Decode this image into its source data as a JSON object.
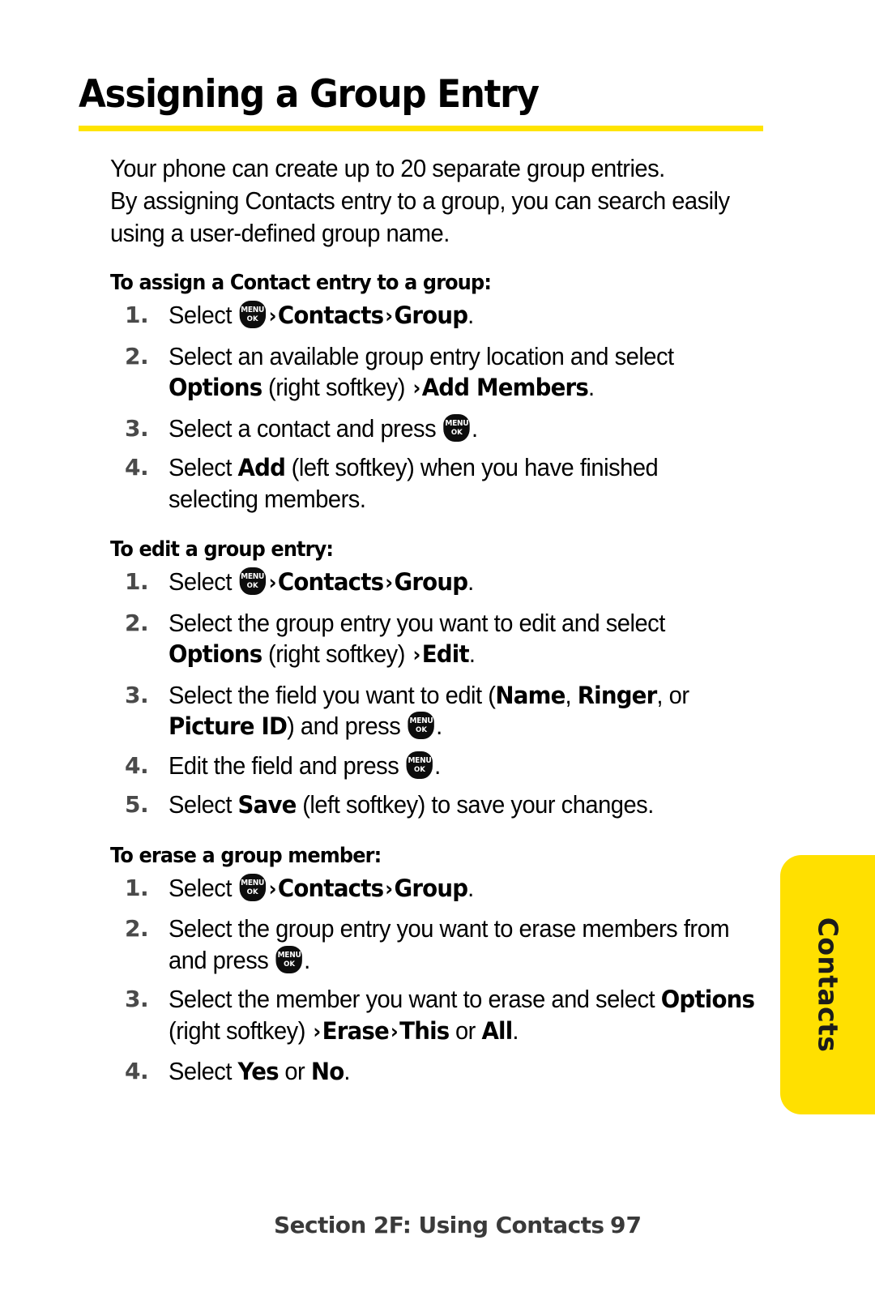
{
  "page": {
    "title": "Assigning a Group Entry",
    "accent_color": "#FFE400",
    "side_tab_label": "Contacts"
  },
  "intro": {
    "line1": "Your phone can create up to 20 separate group entries.",
    "line2": "By assigning Contacts entry to a group, you can search easily",
    "line3": "using a user-defined group name."
  },
  "sections": [
    {
      "heading": "To assign a Contact entry to a group:",
      "steps": [
        {
          "number": "1.",
          "parts": [
            {
              "t": "text",
              "v": "Select "
            },
            {
              "t": "menukey"
            },
            {
              "t": "gt"
            },
            {
              "t": "bold",
              "v": "Contacts"
            },
            {
              "t": "gt"
            },
            {
              "t": "bold",
              "v": "Group"
            },
            {
              "t": "text",
              "v": "."
            }
          ]
        },
        {
          "number": "2.",
          "parts": [
            {
              "t": "text",
              "v": "Select an available group entry location and select"
            },
            {
              "t": "br"
            },
            {
              "t": "bold",
              "v": "Options"
            },
            {
              "t": "text",
              "v": " (right softkey) "
            },
            {
              "t": "gt"
            },
            {
              "t": "bold",
              "v": "Add Members"
            },
            {
              "t": "text",
              "v": "."
            }
          ]
        },
        {
          "number": "3.",
          "parts": [
            {
              "t": "text",
              "v": "Select a contact and press "
            },
            {
              "t": "menukey"
            },
            {
              "t": "text",
              "v": "."
            }
          ]
        },
        {
          "number": "4.",
          "parts": [
            {
              "t": "text",
              "v": "Select "
            },
            {
              "t": "bold",
              "v": "Add"
            },
            {
              "t": "text",
              "v": " (left softkey) when you have finished"
            },
            {
              "t": "br"
            },
            {
              "t": "text",
              "v": "selecting members."
            }
          ]
        }
      ]
    },
    {
      "heading": "To edit a group entry:",
      "steps": [
        {
          "number": "1.",
          "parts": [
            {
              "t": "text",
              "v": "Select "
            },
            {
              "t": "menukey"
            },
            {
              "t": "gt"
            },
            {
              "t": "bold",
              "v": "Contacts"
            },
            {
              "t": "gt"
            },
            {
              "t": "bold",
              "v": "Group"
            },
            {
              "t": "text",
              "v": "."
            }
          ]
        },
        {
          "number": "2.",
          "parts": [
            {
              "t": "text",
              "v": "Select the group entry you want to edit and select"
            },
            {
              "t": "br"
            },
            {
              "t": "bold",
              "v": "Options"
            },
            {
              "t": "text",
              "v": " (right softkey) "
            },
            {
              "t": "gt"
            },
            {
              "t": "bold",
              "v": "Edit"
            },
            {
              "t": "text",
              "v": "."
            }
          ]
        },
        {
          "number": "3.",
          "parts": [
            {
              "t": "text",
              "v": "Select the field you want to edit ("
            },
            {
              "t": "bold",
              "v": "Name"
            },
            {
              "t": "text",
              "v": ", "
            },
            {
              "t": "bold",
              "v": "Ringer"
            },
            {
              "t": "text",
              "v": ", or"
            },
            {
              "t": "br"
            },
            {
              "t": "bold",
              "v": "Picture ID"
            },
            {
              "t": "text",
              "v": ") and press "
            },
            {
              "t": "menukey"
            },
            {
              "t": "text",
              "v": "."
            }
          ]
        },
        {
          "number": "4.",
          "parts": [
            {
              "t": "text",
              "v": "Edit the field and press "
            },
            {
              "t": "menukey"
            },
            {
              "t": "text",
              "v": "."
            }
          ]
        },
        {
          "number": "5.",
          "parts": [
            {
              "t": "text",
              "v": "Select "
            },
            {
              "t": "bold",
              "v": "Save"
            },
            {
              "t": "text",
              "v": " (left softkey) to save your changes."
            }
          ]
        }
      ]
    },
    {
      "heading": "To erase a group member:",
      "steps": [
        {
          "number": "1.",
          "parts": [
            {
              "t": "text",
              "v": "Select "
            },
            {
              "t": "menukey"
            },
            {
              "t": "gt"
            },
            {
              "t": "bold",
              "v": "Contacts"
            },
            {
              "t": "gt"
            },
            {
              "t": "bold",
              "v": "Group"
            },
            {
              "t": "text",
              "v": "."
            }
          ]
        },
        {
          "number": "2.",
          "parts": [
            {
              "t": "text",
              "v": "Select the group entry you want to erase members from"
            },
            {
              "t": "br"
            },
            {
              "t": "text",
              "v": "and press "
            },
            {
              "t": "menukey"
            },
            {
              "t": "text",
              "v": "."
            }
          ]
        },
        {
          "number": "3.",
          "parts": [
            {
              "t": "text",
              "v": "Select the member you want to erase and select "
            },
            {
              "t": "bold",
              "v": "Options"
            },
            {
              "t": "br"
            },
            {
              "t": "text",
              "v": "(right softkey) "
            },
            {
              "t": "gt"
            },
            {
              "t": "bold",
              "v": "Erase"
            },
            {
              "t": "gt"
            },
            {
              "t": "bold",
              "v": "This"
            },
            {
              "t": "text",
              "v": " or "
            },
            {
              "t": "bold",
              "v": "All"
            },
            {
              "t": "text",
              "v": "."
            }
          ]
        },
        {
          "number": "4.",
          "parts": [
            {
              "t": "text",
              "v": "Select "
            },
            {
              "t": "bold",
              "v": "Yes"
            },
            {
              "t": "text",
              "v": " or "
            },
            {
              "t": "bold",
              "v": "No"
            },
            {
              "t": "text",
              "v": "."
            }
          ]
        }
      ]
    }
  ],
  "menukey": {
    "line1": "MENU",
    "line2": "OK"
  },
  "footer": {
    "section_text": "Section 2F: Using Contacts",
    "page_number": "97"
  }
}
